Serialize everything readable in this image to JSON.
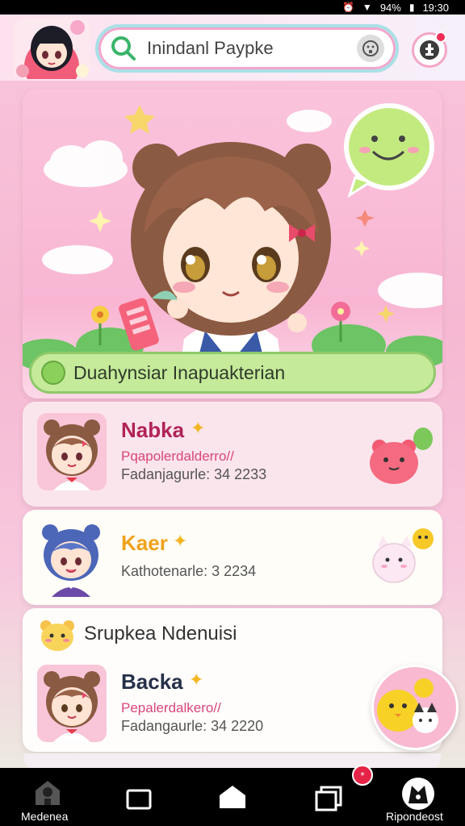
{
  "status_bar": {
    "battery_text": "94%",
    "time": "19:30"
  },
  "header": {
    "search_text": "Inindanl Paypke"
  },
  "hero": {
    "banner_text": "Duahynsiar Inapuakterian"
  },
  "cards": [
    {
      "name": "Nabka",
      "name_color": "#b02356",
      "sub": "Pqapolerdalderro//",
      "meta": "Fadanjagurle: 34 2233"
    },
    {
      "name": "Kaer",
      "name_color": "#f0a21a",
      "meta": "Kathotenarle: 3 2234"
    },
    {
      "section_title": "Srupkea Ndenuisi",
      "name": "Backa",
      "name_color": "#27304a",
      "sub": "Pepalerdalkero//",
      "meta": "Fadangaurle: 34 2220"
    }
  ],
  "bottom_nav": {
    "items": [
      {
        "label": "Medenea",
        "icon": "home-house-icon"
      },
      {
        "label": "",
        "icon": "window-icon"
      },
      {
        "label": "",
        "icon": "home-icon"
      },
      {
        "label": "",
        "icon": "stack-icon"
      },
      {
        "label": "Ripondeost",
        "icon": "profile-icon"
      }
    ],
    "badge": "*"
  },
  "colors": {
    "accent_pink": "#f4a6c7",
    "accent_green": "#8fc96b",
    "nav_bg": "#000000"
  }
}
